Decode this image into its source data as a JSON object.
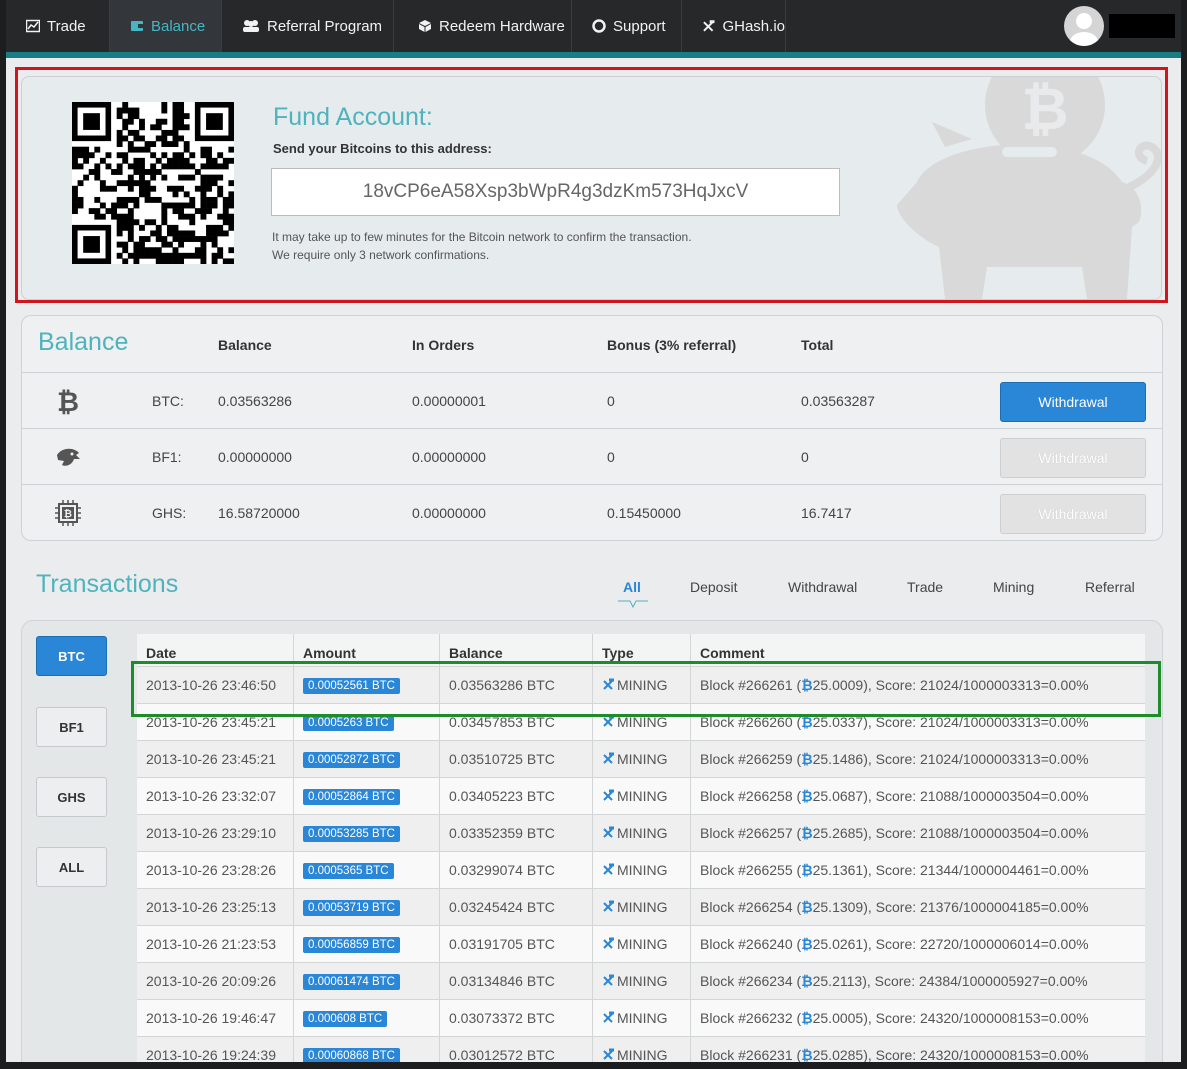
{
  "nav": {
    "items": [
      {
        "label": "Trade",
        "icon": "chart-icon"
      },
      {
        "label": "Balance",
        "icon": "wallet-icon"
      },
      {
        "label": "Referral Program",
        "icon": "users-icon"
      },
      {
        "label": "Redeem Hardware",
        "icon": "box-icon"
      },
      {
        "label": "Support",
        "icon": "lifebuoy-icon"
      },
      {
        "label": "GHash.io",
        "icon": "tools-icon"
      }
    ],
    "active": "Balance"
  },
  "fund": {
    "title": "Fund Account:",
    "subtitle": "Send your Bitcoins to this address:",
    "address": "18vCP6eA58Xsp3bWpR4g3dzKm573HqJxcV",
    "note1": "It may take up to few minutes for the Bitcoin network to confirm the transaction.",
    "note2": "We require only 3 network confirmations."
  },
  "balance": {
    "title": "Balance",
    "headers": {
      "balance": "Balance",
      "in_orders": "In Orders",
      "bonus": "Bonus (3% referral)",
      "total": "Total"
    },
    "rows": [
      {
        "currency": "BTC:",
        "balance": "0.03563286",
        "in_orders": "0.00000001",
        "bonus": "0",
        "total": "0.03563287",
        "button": "Withdrawal",
        "enabled": true
      },
      {
        "currency": "BF1:",
        "balance": "0.00000000",
        "in_orders": "0.00000000",
        "bonus": "0",
        "total": "0",
        "button": "Withdrawal",
        "enabled": false
      },
      {
        "currency": "GHS:",
        "balance": "16.58720000",
        "in_orders": "0.00000000",
        "bonus": "0.15450000",
        "total": "16.7417",
        "button": "Withdrawal",
        "enabled": false
      }
    ]
  },
  "transactions": {
    "title": "Transactions",
    "tabs": [
      "All",
      "Deposit",
      "Withdrawal",
      "Trade",
      "Mining",
      "Referral"
    ],
    "active_tab": "All",
    "currencies": [
      "BTC",
      "BF1",
      "GHS",
      "ALL"
    ],
    "active_currency": "BTC",
    "headers": {
      "date": "Date",
      "amount": "Amount",
      "balance": "Balance",
      "type": "Type",
      "comment": "Comment"
    },
    "rows": [
      {
        "date": "2013-10-26 23:46:50",
        "amount": "0.00052561 BTC",
        "balance": "0.03563286 BTC",
        "type": "MINING",
        "block": "Block #266261 (",
        "reward": "25.0009",
        "score": "), Score: 21024/1000003313=0.00%"
      },
      {
        "date": "2013-10-26 23:45:21",
        "amount": "0.0005263 BTC",
        "balance": "0.03457853 BTC",
        "type": "MINING",
        "block": "Block #266260 (",
        "reward": "25.0337",
        "score": "), Score: 21024/1000003313=0.00%"
      },
      {
        "date": "2013-10-26 23:45:21",
        "amount": "0.00052872 BTC",
        "balance": "0.03510725 BTC",
        "type": "MINING",
        "block": "Block #266259 (",
        "reward": "25.1486",
        "score": "), Score: 21024/1000003313=0.00%"
      },
      {
        "date": "2013-10-26 23:32:07",
        "amount": "0.00052864 BTC",
        "balance": "0.03405223 BTC",
        "type": "MINING",
        "block": "Block #266258 (",
        "reward": "25.0687",
        "score": "), Score: 21088/1000003504=0.00%"
      },
      {
        "date": "2013-10-26 23:29:10",
        "amount": "0.00053285 BTC",
        "balance": "0.03352359 BTC",
        "type": "MINING",
        "block": "Block #266257 (",
        "reward": "25.2685",
        "score": "), Score: 21088/1000003504=0.00%"
      },
      {
        "date": "2013-10-26 23:28:26",
        "amount": "0.0005365 BTC",
        "balance": "0.03299074 BTC",
        "type": "MINING",
        "block": "Block #266255 (",
        "reward": "25.1361",
        "score": "), Score: 21344/1000004461=0.00%"
      },
      {
        "date": "2013-10-26 23:25:13",
        "amount": "0.00053719 BTC",
        "balance": "0.03245424 BTC",
        "type": "MINING",
        "block": "Block #266254 (",
        "reward": "25.1309",
        "score": "), Score: 21376/1000004185=0.00%"
      },
      {
        "date": "2013-10-26 21:23:53",
        "amount": "0.00056859 BTC",
        "balance": "0.03191705 BTC",
        "type": "MINING",
        "block": "Block #266240 (",
        "reward": "25.0261",
        "score": "), Score: 22720/1000006014=0.00%"
      },
      {
        "date": "2013-10-26 20:09:26",
        "amount": "0.00061474 BTC",
        "balance": "0.03134846 BTC",
        "type": "MINING",
        "block": "Block #266234 (",
        "reward": "25.2113",
        "score": "), Score: 24384/1000005927=0.00%"
      },
      {
        "date": "2013-10-26 19:46:47",
        "amount": "0.000608 BTC",
        "balance": "0.03073372 BTC",
        "type": "MINING",
        "block": "Block #266232 (",
        "reward": "25.0005",
        "score": "), Score: 24320/1000008153=0.00%"
      },
      {
        "date": "2013-10-26 19:24:39",
        "amount": "0.00060868 BTC",
        "balance": "0.03012572 BTC",
        "type": "MINING",
        "block": "Block #266231 (",
        "reward": "25.0285",
        "score": "), Score: 24320/1000008153=0.00%"
      }
    ]
  },
  "colors": {
    "accent": "#4fb3bd",
    "primary_button": "#2a86d6",
    "highlight_red": "#d0161c",
    "highlight_green": "#1f8c2c"
  }
}
